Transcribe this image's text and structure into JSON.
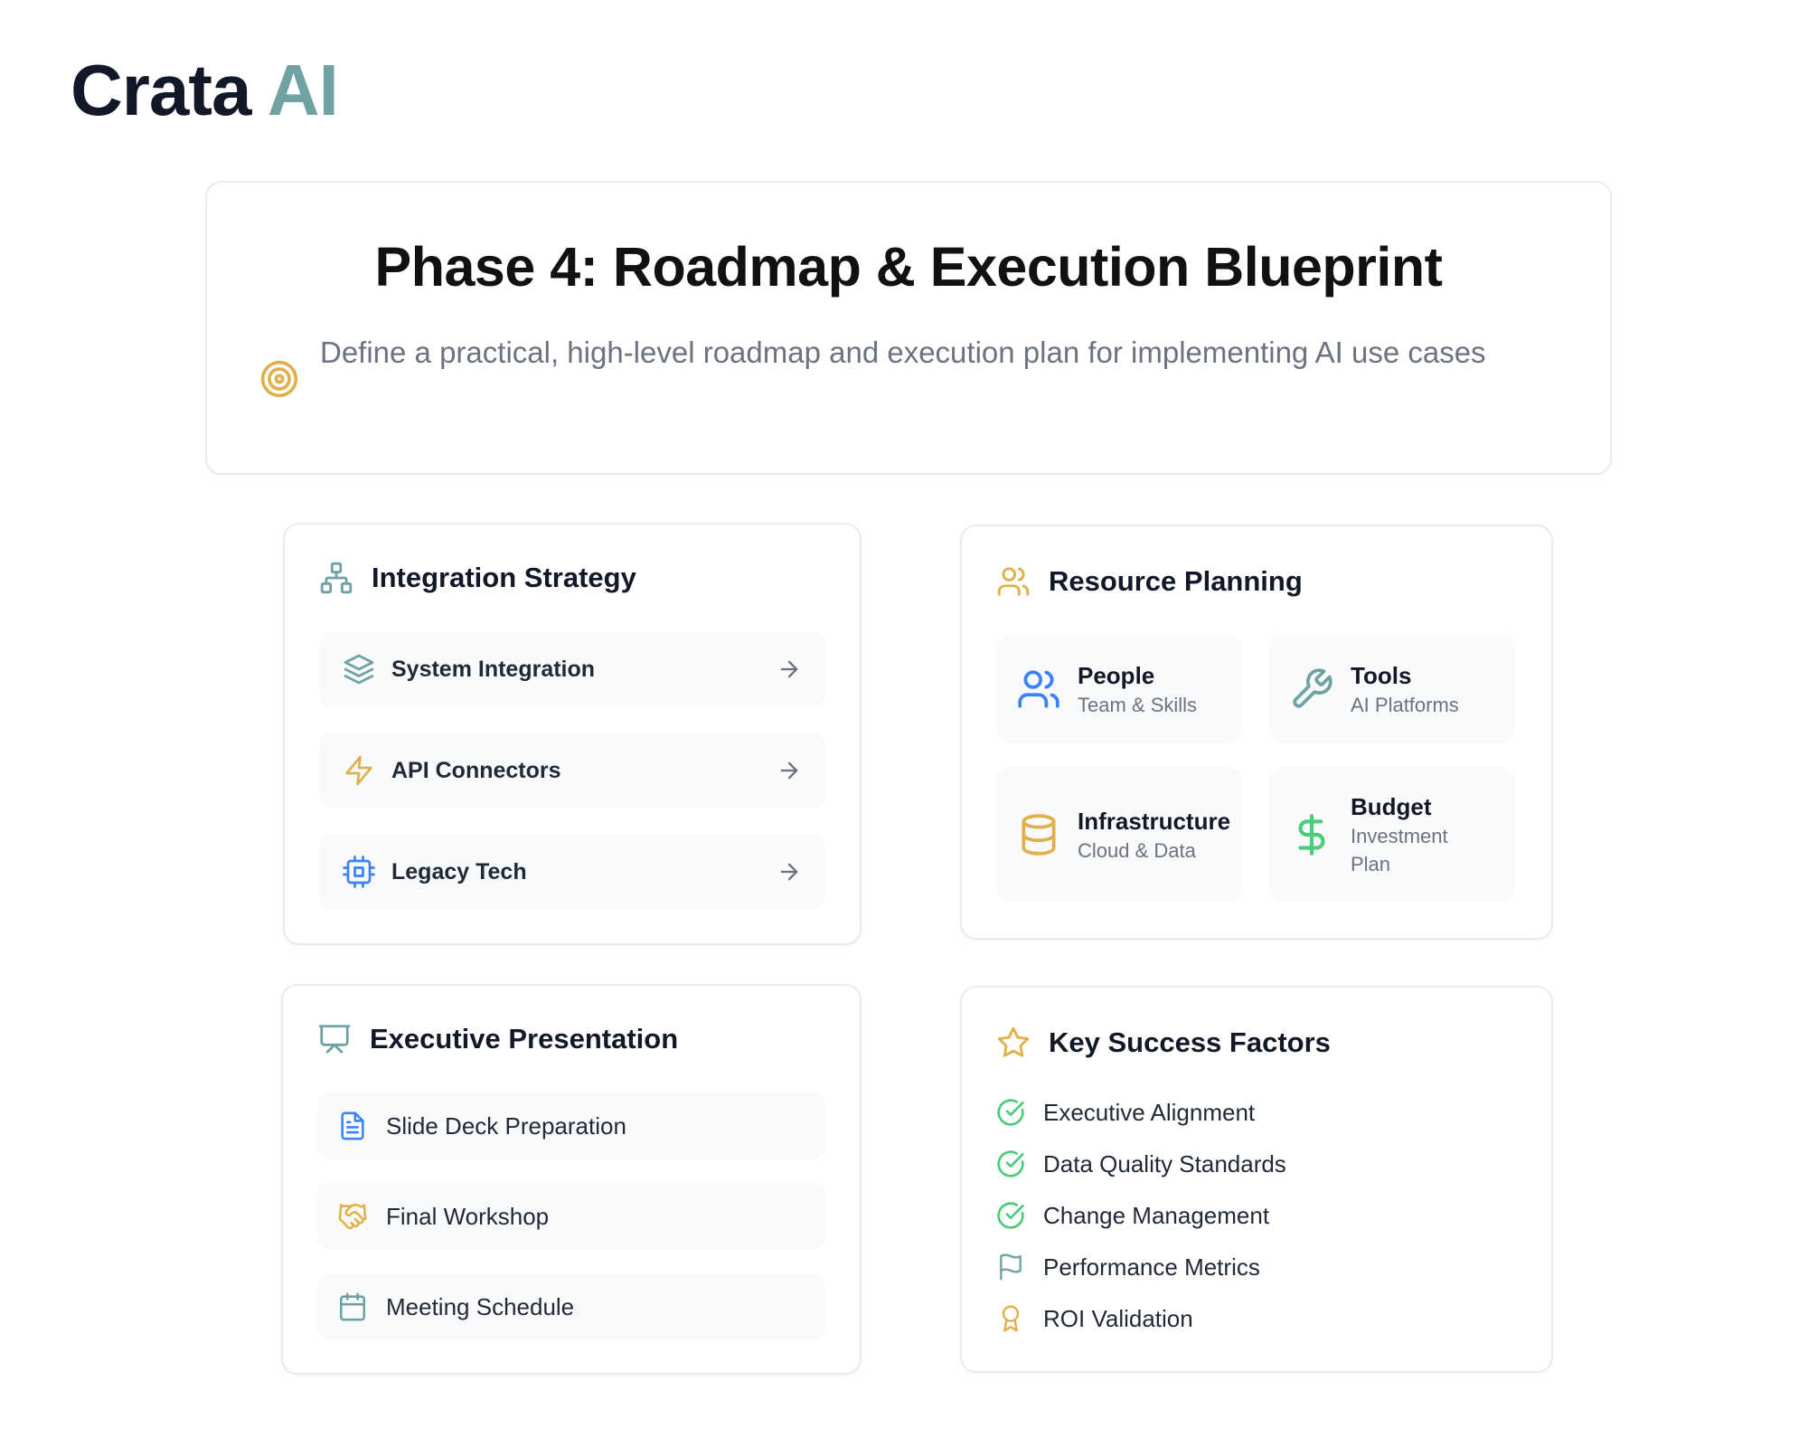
{
  "brand": {
    "name": "Crata",
    "accent": "AI",
    "accent_color": "#6fa3a3"
  },
  "hero": {
    "title": "Phase 4: Roadmap & Execution Blueprint",
    "subtitle": "Define a practical, high-level roadmap and execution plan for implementing AI use cases",
    "icon": "target-icon"
  },
  "integration": {
    "title": "Integration Strategy",
    "icon": "network-icon",
    "items": [
      {
        "label": "System Integration",
        "icon": "layers-icon"
      },
      {
        "label": "API Connectors",
        "icon": "zap-icon"
      },
      {
        "label": "Legacy Tech",
        "icon": "cpu-icon"
      }
    ]
  },
  "resource": {
    "title": "Resource Planning",
    "icon": "users-icon",
    "tiles": [
      {
        "title": "People",
        "subtitle": "Team & Skills",
        "icon": "users-icon"
      },
      {
        "title": "Tools",
        "subtitle": "AI Platforms",
        "icon": "wrench-icon"
      },
      {
        "title": "Infrastructure",
        "subtitle": "Cloud & Data",
        "icon": "database-icon"
      },
      {
        "title": "Budget",
        "subtitle": "Investment Plan",
        "icon": "dollar-icon"
      }
    ]
  },
  "executive": {
    "title": "Executive Presentation",
    "icon": "presentation-icon",
    "items": [
      {
        "label": "Slide Deck Preparation",
        "icon": "file-text-icon"
      },
      {
        "label": "Final Workshop",
        "icon": "handshake-icon"
      },
      {
        "label": "Meeting Schedule",
        "icon": "calendar-icon"
      }
    ]
  },
  "success": {
    "title": "Key Success Factors",
    "icon": "star-icon",
    "items": [
      {
        "label": "Executive Alignment",
        "icon": "check-circle-icon"
      },
      {
        "label": "Data Quality Standards",
        "icon": "check-circle-icon"
      },
      {
        "label": "Change Management",
        "icon": "check-circle-icon"
      },
      {
        "label": "Performance Metrics",
        "icon": "flag-icon"
      },
      {
        "label": "ROI Validation",
        "icon": "award-icon"
      }
    ]
  },
  "colors": {
    "teal": "#6fa3a3",
    "gold": "#e0b04a",
    "blue": "#3b82f6",
    "green": "#4ccb7a"
  }
}
